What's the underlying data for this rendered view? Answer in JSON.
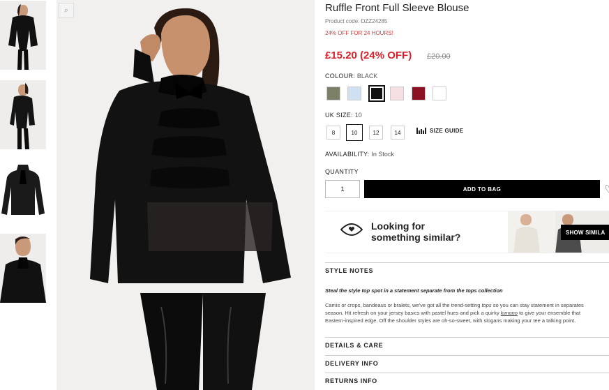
{
  "product": {
    "title": "Ruffle Front Full Sleeve Blouse",
    "code_label": "Product code: DZZ24285",
    "promo": "24% OFF FOR 24 HOURS!",
    "price": "£15.20 (24% OFF)",
    "was_price": "£20.00"
  },
  "colour": {
    "label": "COLOUR:",
    "value": "BLACK",
    "swatches": [
      {
        "name": "khaki",
        "color": "#7b8066"
      },
      {
        "name": "light-blue",
        "color": "#cfe0f2"
      },
      {
        "name": "black",
        "color": "#111111",
        "selected": true
      },
      {
        "name": "pink",
        "color": "#f6dfe2"
      },
      {
        "name": "burgundy",
        "color": "#8b1022"
      },
      {
        "name": "white",
        "color": "#ffffff"
      }
    ]
  },
  "size": {
    "label": "UK SIZE:",
    "value": "10",
    "options": [
      "8",
      "10",
      "12",
      "14"
    ],
    "selected": "10",
    "guide_label": "SIZE GUIDE"
  },
  "availability": {
    "label": "AVAILABILITY:",
    "value": "In Stock"
  },
  "quantity": {
    "label": "QUANTITY",
    "value": "1"
  },
  "actions": {
    "add_to_bag": "ADD TO BAG"
  },
  "similar": {
    "line1": "Looking for",
    "line2": "something similar?",
    "button": "SHOW SIMILA"
  },
  "style_notes": {
    "heading": "STYLE NOTES",
    "lead": "Steal the style top spot in a statement separate from the tops collection",
    "line1_a": "Camis or crops, bandeaus or bralets, we've got all the trend-setting ",
    "line1_em": "tops",
    "line1_b": " so you can stay statement in separates",
    "line2_a": "season. Hit refresh on your jersey basics with pastel hues and pick a quirky ",
    "line2_link": "kimono",
    "line2_b": " to give your ensemble that",
    "line3": "Eastern-inspired edge. Off the shoulder styles are oh-so-sweet, with slogans making your tee a talking point."
  },
  "sections": {
    "details": "DETAILS & CARE",
    "delivery": "DELIVERY INFO",
    "returns": "RETURNS INFO"
  },
  "colors": {
    "accent_red": "#d8202a",
    "button_black": "#000000"
  }
}
